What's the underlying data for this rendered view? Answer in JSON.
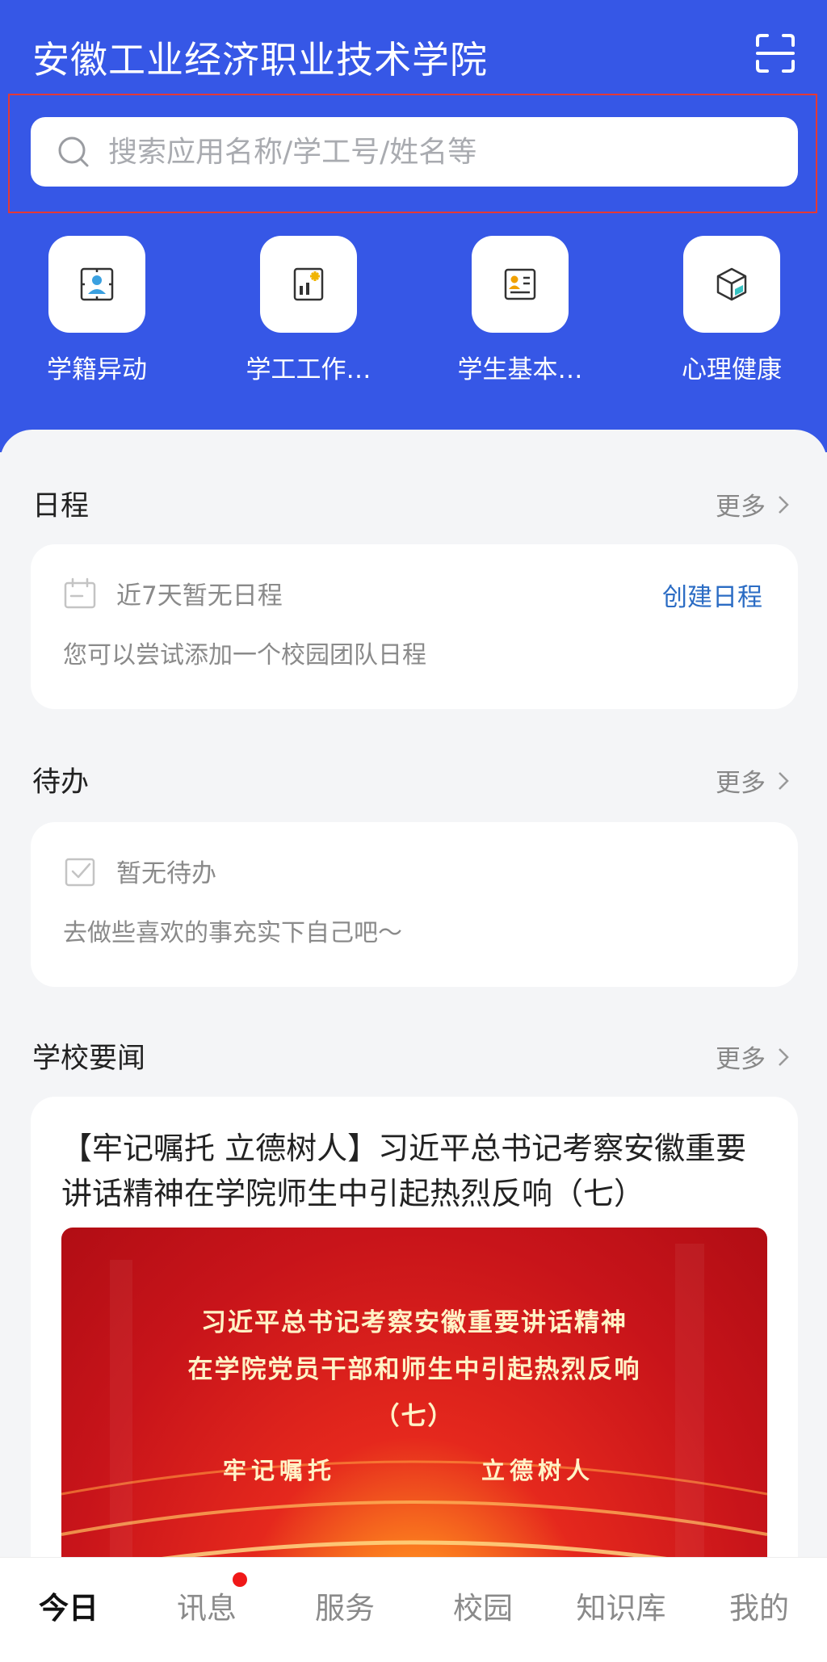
{
  "header": {
    "title": "安徽工业经济职业技术学院",
    "scan_icon": "scan-icon",
    "search_placeholder": "搜索应用名称/学工号/姓名等"
  },
  "quick_apps": [
    {
      "label": "学籍异动",
      "icon": "student-status-icon"
    },
    {
      "label": "学工工作…",
      "icon": "student-work-icon"
    },
    {
      "label": "学生基本…",
      "icon": "student-info-icon"
    },
    {
      "label": "心理健康",
      "icon": "mental-health-icon"
    }
  ],
  "schedule": {
    "title": "日程",
    "more": "更多",
    "empty_title": "近7天暂无日程",
    "create": "创建日程",
    "hint": "您可以尝试添加一个校园团队日程"
  },
  "todo": {
    "title": "待办",
    "more": "更多",
    "empty_title": "暂无待办",
    "hint": "去做些喜欢的事充实下自己吧～"
  },
  "news": {
    "title": "学校要闻",
    "more": "更多",
    "item_title": "【牢记嘱托 立德树人】习近平总书记考察安徽重要讲话精神在学院师生中引起热烈反响（七）",
    "banner_line1": "习近平总书记考察安徽重要讲话精神",
    "banner_line2": "在学院党员干部和师生中引起热烈反响",
    "banner_line3": "（七）",
    "banner_motto_left": "牢记嘱托",
    "banner_motto_right": "立德树人"
  },
  "tabbar": {
    "tabs": [
      "今日",
      "讯息",
      "服务",
      "校园",
      "知识库",
      "我的"
    ],
    "active": "今日"
  },
  "colors": {
    "header_blue": "#3657e6",
    "link_blue": "#2b6cc4",
    "badge_red": "#f01818",
    "banner_red": "#c8141a"
  }
}
